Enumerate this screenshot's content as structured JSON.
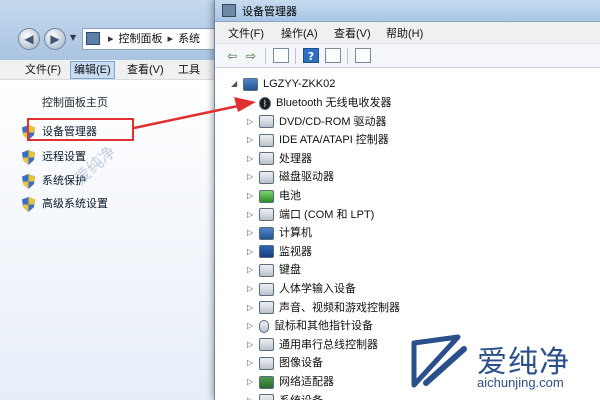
{
  "back_window": {
    "address_segments": [
      "控制面板",
      "系统"
    ],
    "address_separator": "▸",
    "menu": [
      "文件(F)",
      "编辑(E)",
      "查看(V)",
      "工具"
    ],
    "home_link": "控制面板主页",
    "links": [
      "设备管理器",
      "远程设置",
      "系统保护",
      "高级系统设置"
    ]
  },
  "device_manager": {
    "title": "设备管理器",
    "menu": [
      "文件(F)",
      "操作(A)",
      "查看(V)",
      "帮助(H)"
    ],
    "computer_name": "LGZYY-ZKK02",
    "devices": [
      {
        "label": "Bluetooth 无线电收发器",
        "icon": "bluetooth-icon"
      },
      {
        "label": "DVD/CD-ROM 驱动器",
        "icon": "dvd-drive-icon"
      },
      {
        "label": "IDE ATA/ATAPI 控制器",
        "icon": "ide-controller-icon"
      },
      {
        "label": "处理器",
        "icon": "processor-icon"
      },
      {
        "label": "磁盘驱动器",
        "icon": "disk-drive-icon"
      },
      {
        "label": "电池",
        "icon": "battery-icon"
      },
      {
        "label": "端口 (COM 和 LPT)",
        "icon": "port-icon"
      },
      {
        "label": "计算机",
        "icon": "computer-icon"
      },
      {
        "label": "监视器",
        "icon": "monitor-icon"
      },
      {
        "label": "键盘",
        "icon": "keyboard-icon"
      },
      {
        "label": "人体学输入设备",
        "icon": "hid-icon"
      },
      {
        "label": "声音、视频和游戏控制器",
        "icon": "sound-icon"
      },
      {
        "label": "鼠标和其他指针设备",
        "icon": "mouse-icon"
      },
      {
        "label": "通用串行总线控制器",
        "icon": "usb-icon"
      },
      {
        "label": "图像设备",
        "icon": "imaging-icon"
      },
      {
        "label": "网络适配器",
        "icon": "network-icon"
      },
      {
        "label": "系统设备",
        "icon": "system-icon"
      }
    ]
  },
  "watermark": {
    "diagonal": "爱纯净",
    "brand": "爱纯净",
    "site": "aichunjing.com"
  },
  "colors": {
    "highlight": "#e03030",
    "brand": "#2b4f8a"
  }
}
